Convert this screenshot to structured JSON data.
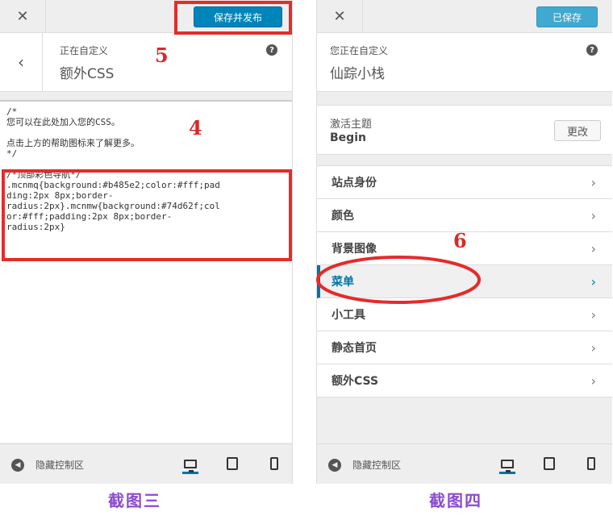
{
  "screenshot3": {
    "close_icon": "close-icon",
    "publish_label": "保存并发布",
    "header_sub": "正在自定义",
    "header_title": "额外CSS",
    "code_lines": [
      "/*",
      "您可以在此处加入您的CSS。",
      "",
      "点击上方的帮助图标来了解更多。",
      "*/",
      "",
      "/*顶部彩色导航*/",
      ".mcnmq{background:#b485e2;color:#fff;pad",
      "ding:2px 8px;border-",
      "radius:2px}.mcnmw{background:#74d62f;col",
      "or:#fff;padding:2px 8px;border-",
      "radius:2px}"
    ],
    "hide_controls_label": "隐藏控制区",
    "annotation_5": "5",
    "annotation_4": "4",
    "caption": "截图三"
  },
  "screenshot4": {
    "saved_label": "已保存",
    "header_sub": "您正在自定义",
    "header_title": "仙踪小栈",
    "theme_label": "激活主题",
    "theme_name": "Begin",
    "change_label": "更改",
    "menu_items": [
      "站点身份",
      "颜色",
      "背景图像",
      "菜单",
      "小工具",
      "静态首页",
      "额外CSS"
    ],
    "hide_controls_label": "隐藏控制区",
    "annotation_6": "6",
    "caption": "截图四"
  },
  "colors": {
    "accent_blue": "#0073aa",
    "annotation_red": "#e52b2b",
    "caption_purple": "#8a4bd1",
    "saved_button": "#2ea2cc"
  }
}
